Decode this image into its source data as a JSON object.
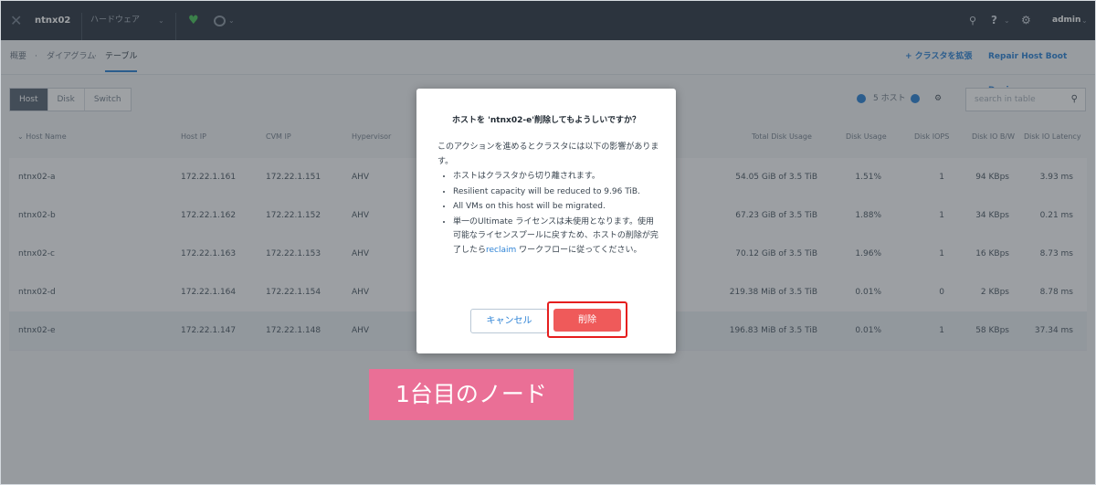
{
  "topbar": {
    "logo_glyph": "✕",
    "cluster_name": "ntnx02",
    "menu_label": "ハードウェア",
    "caret": "⌄",
    "heart_glyph": "♥",
    "search_glyph": "🔍",
    "help_glyph": "?",
    "gear_glyph": "⚙",
    "user": "admin"
  },
  "subnav": {
    "crumbs": [
      "概要",
      "ダイアグラム",
      "テーブル"
    ],
    "sep": "·",
    "expand_link": "+ クラスタを拡張",
    "repair_link": "Repair Host Boot Device"
  },
  "filters": {
    "tabs": [
      "Host",
      "Disk",
      "Switch"
    ],
    "host_count": "5 ホスト",
    "search_placeholder": "search in table"
  },
  "table": {
    "headers": [
      "Host Name",
      "Host IP",
      "CVM IP",
      "Hypervisor",
      "Total Disk Usage",
      "Disk Usage",
      "Disk IOPS",
      "Disk IO B/W",
      "Disk IO Latency"
    ],
    "rows": [
      {
        "name": "ntnx02-a",
        "host_ip": "172.22.1.161",
        "cvm_ip": "172.22.1.151",
        "hyp": "AHV",
        "total": "54.05 GiB of 3.5 TiB",
        "usage": "1.51%",
        "iops": "1",
        "bw": "94 KBps",
        "lat": "3.93 ms"
      },
      {
        "name": "ntnx02-b",
        "host_ip": "172.22.1.162",
        "cvm_ip": "172.22.1.152",
        "hyp": "AHV",
        "total": "67.23 GiB of 3.5 TiB",
        "usage": "1.88%",
        "iops": "1",
        "bw": "34 KBps",
        "lat": "0.21 ms"
      },
      {
        "name": "ntnx02-c",
        "host_ip": "172.22.1.163",
        "cvm_ip": "172.22.1.153",
        "hyp": "AHV",
        "total": "70.12 GiB of 3.5 TiB",
        "usage": "1.96%",
        "iops": "1",
        "bw": "16 KBps",
        "lat": "8.73 ms"
      },
      {
        "name": "ntnx02-d",
        "host_ip": "172.22.1.164",
        "cvm_ip": "172.22.1.154",
        "hyp": "AHV",
        "total": "219.38 MiB of 3.5 TiB",
        "usage": "0.01%",
        "iops": "0",
        "bw": "2 KBps",
        "lat": "8.78 ms"
      },
      {
        "name": "ntnx02-e",
        "host_ip": "172.22.1.147",
        "cvm_ip": "172.22.1.148",
        "hyp": "AHV",
        "total": "196.83 MiB of 3.5 TiB",
        "usage": "0.01%",
        "iops": "1",
        "bw": "58 KBps",
        "lat": "37.34 ms"
      }
    ]
  },
  "dialog": {
    "title": "ホストを 'ntnx02-e'削除してもようしいですか？",
    "intro": "このアクションを進めるとクラスタには以下の影響があります。",
    "bullet1": "ホストはクラスタから切り離されます。",
    "bullet2": "Resilient capacity will be reduced to 9.96 TiB.",
    "bullet3": "All VMs on this host will be migrated.",
    "bullet4_pre": "単一のUltimate ライセンスは未使用となります。使用可能なライセンスプールに戻すため、ホストの削除が完了したら",
    "bullet4_link": "reclaim",
    "bullet4_post": " ワークフローに従ってください。",
    "cancel": "キャンセル",
    "delete": "削除"
  },
  "annotation": "1台目のノード"
}
